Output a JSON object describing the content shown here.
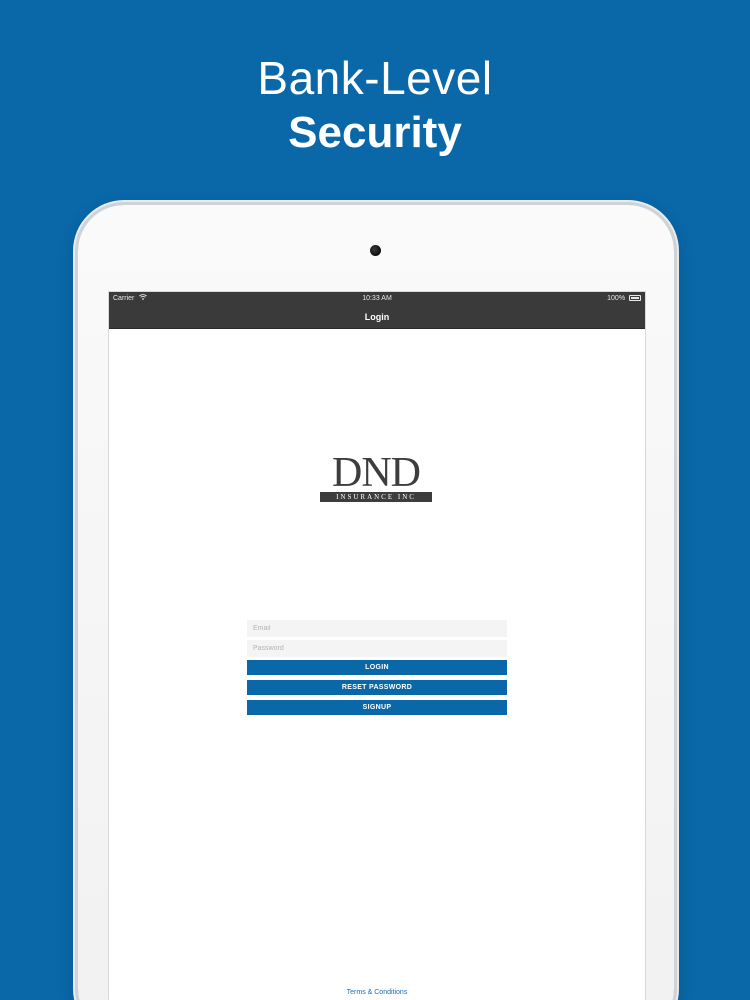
{
  "headline": {
    "line1": "Bank-Level",
    "line2": "Security"
  },
  "status_bar": {
    "carrier": "Carrier",
    "time": "10:33 AM",
    "battery": "100%"
  },
  "nav": {
    "title": "Login"
  },
  "logo": {
    "main": "DND",
    "sub": "INSURANCE INC"
  },
  "form": {
    "email_placeholder": "Email",
    "password_placeholder": "Password",
    "login_label": "LOGIN",
    "reset_label": "RESET PASSWORD",
    "signup_label": "SIGNUP"
  },
  "footer": {
    "terms_label": "Terms & Conditions"
  },
  "colors": {
    "brand_blue": "#0a67a8",
    "status_bar": "#3a3a3a"
  }
}
